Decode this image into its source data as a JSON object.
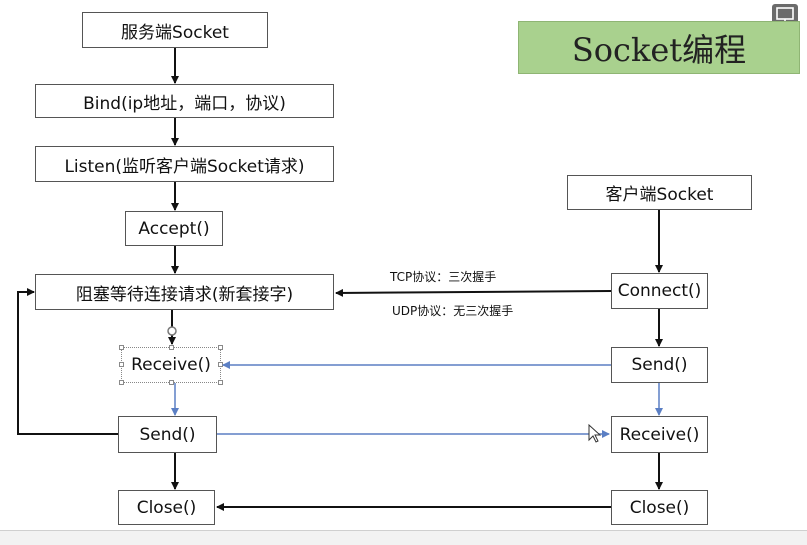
{
  "title": "Socket编程",
  "server": {
    "socket": "服务端Socket",
    "bind": "Bind(ip地址，端口，协议)",
    "listen": "Listen(监听客户端Socket请求)",
    "accept": "Accept()",
    "wait": "阻塞等待连接请求(新套接字)",
    "receive": "Receive()",
    "send": "Send()",
    "close": "Close()"
  },
  "client": {
    "socket": "客户端Socket",
    "connect": "Connect()",
    "send": "Send()",
    "receive": "Receive()",
    "close": "Close()"
  },
  "notes": {
    "tcp": "TCP协议：三次握手",
    "udp": "UDP协议：无三次握手"
  },
  "colors": {
    "title_bg": "#a9d18e",
    "arrow_black": "#111111",
    "arrow_blue": "#5b7fc4"
  },
  "icons": [
    "presentation-icon"
  ]
}
